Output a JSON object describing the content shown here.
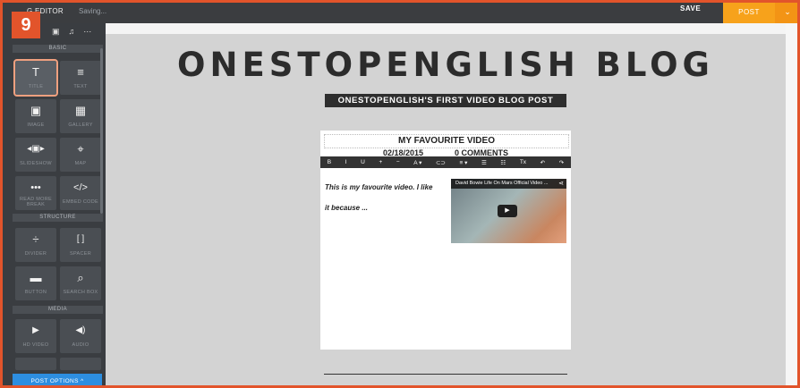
{
  "header": {
    "step_number": "9",
    "app_title": "G EDITOR",
    "status": "Saving...",
    "save_label": "SAVE",
    "post_label": "POST",
    "post_dropdown_icon": "chevron-down-icon"
  },
  "sidebar": {
    "top_icons": [
      "layout-icon",
      "music-icon",
      "more-icon"
    ],
    "sections": {
      "basic": "BASIC",
      "structure": "STRUCTURE",
      "media": "MEDIA"
    },
    "basic_items": [
      {
        "label": "TITLE",
        "icon": "title-icon",
        "glyph": "T"
      },
      {
        "label": "TEXT",
        "icon": "text-icon",
        "glyph": "≡"
      },
      {
        "label": "IMAGE",
        "icon": "image-icon",
        "glyph": "▣"
      },
      {
        "label": "GALLERY",
        "icon": "gallery-icon",
        "glyph": "▦"
      },
      {
        "label": "SLIDESHOW",
        "icon": "slideshow-icon",
        "glyph": "◂▣▸"
      },
      {
        "label": "MAP",
        "icon": "map-icon",
        "glyph": "⌖"
      },
      {
        "label": "READ MORE BREAK",
        "icon": "read-more-icon",
        "glyph": "•••"
      },
      {
        "label": "EMBED CODE",
        "icon": "embed-code-icon",
        "glyph": "</>"
      }
    ],
    "structure_items": [
      {
        "label": "DIVIDER",
        "icon": "divider-icon",
        "glyph": "÷"
      },
      {
        "label": "SPACER",
        "icon": "spacer-icon",
        "glyph": "[ ]"
      },
      {
        "label": "BUTTON",
        "icon": "button-icon",
        "glyph": "▬"
      },
      {
        "label": "SEARCH BOX",
        "icon": "search-box-icon",
        "glyph": "⌕"
      }
    ],
    "media_items": [
      {
        "label": "HD VIDEO",
        "icon": "video-icon",
        "glyph": "▶"
      },
      {
        "label": "AUDIO",
        "icon": "audio-icon",
        "glyph": "◀)"
      }
    ],
    "post_options": "POST OPTIONS ^"
  },
  "canvas": {
    "blog_title": "ONESTOPENGLISH BLOG",
    "post_subtitle": "ONESTOPENGLISH'S FIRST VIDEO BLOG POST",
    "post": {
      "heading": "MY FAVOURITE VIDEO",
      "date": "02/18/2015",
      "comments": "0 COMMENTS",
      "toolbar": [
        "B",
        "I",
        "U",
        "+",
        "−",
        "A ▾",
        "⊂⊃",
        "≡ ▾",
        "☰",
        "☷",
        "Tx",
        "↶",
        "↷"
      ],
      "body_line1": "This is my favourite video. I like",
      "body_line2": "it because ...",
      "video_title": "David Bowie Life On Mars Official Video ...",
      "share_icon": "share-icon",
      "play_icon": "play-icon"
    }
  }
}
